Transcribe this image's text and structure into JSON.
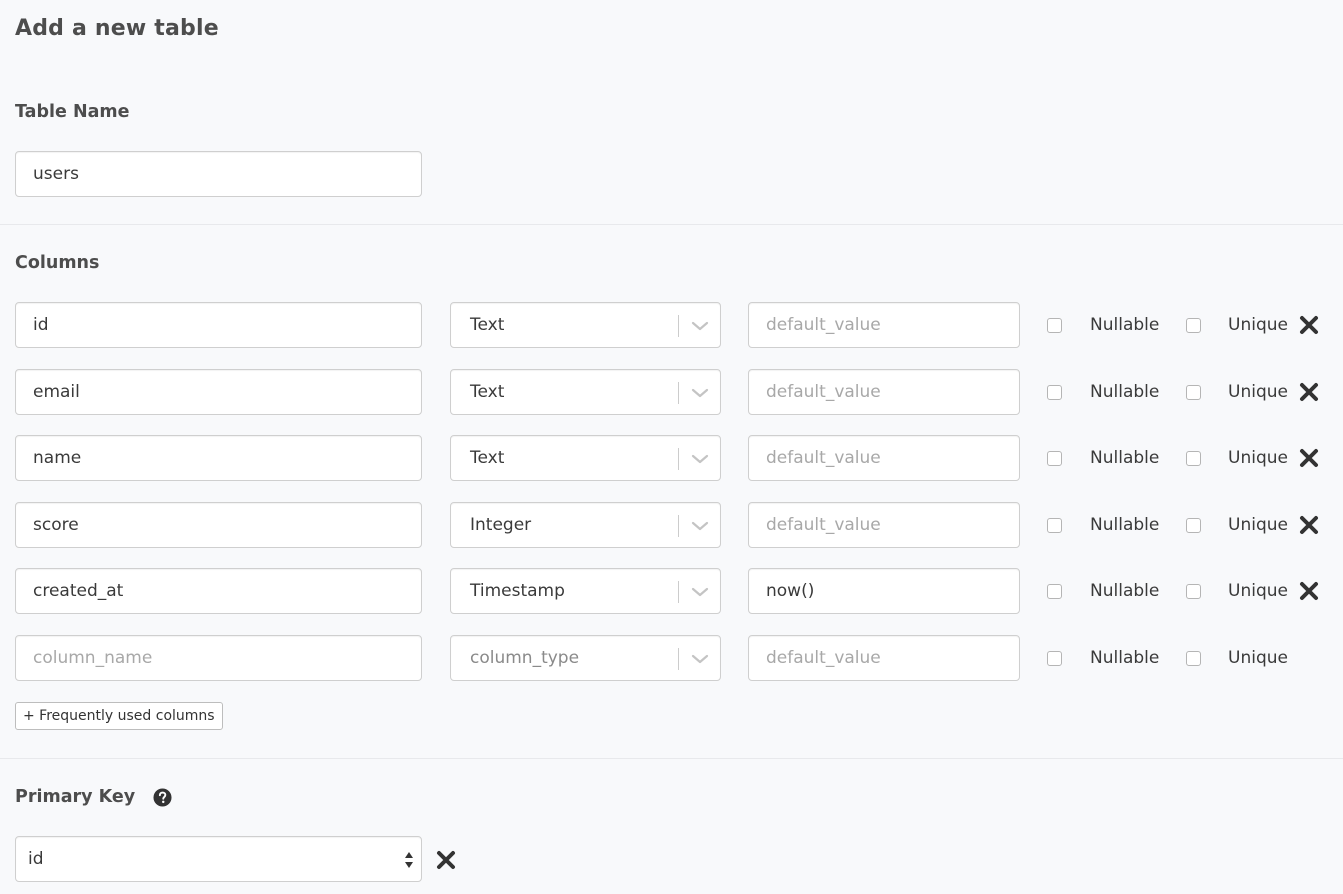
{
  "page_title": "Add a new table",
  "table_name": {
    "label": "Table Name",
    "value": "users"
  },
  "columns": {
    "label": "Columns",
    "nullable_label": "Nullable",
    "unique_label": "Unique",
    "rows": [
      {
        "name": "id",
        "type": "Text",
        "default": ""
      },
      {
        "name": "email",
        "type": "Text",
        "default": ""
      },
      {
        "name": "name",
        "type": "Text",
        "default": ""
      },
      {
        "name": "score",
        "type": "Integer",
        "default": ""
      },
      {
        "name": "created_at",
        "type": "Timestamp",
        "default": "now()"
      }
    ],
    "new_row": {
      "name_placeholder": "column_name",
      "type_placeholder": "column_type",
      "default_placeholder": "default_value"
    },
    "default_placeholder": "default_value"
  },
  "frequently_used_button": "+ Frequently used columns",
  "primary_key": {
    "label": "Primary Key",
    "value": "id"
  },
  "icons": {
    "remove": "close-x-icon",
    "help": "question-circle-icon",
    "dropdown": "chevron-down-icon",
    "select_arrows": "up-down-arrows-icon"
  }
}
